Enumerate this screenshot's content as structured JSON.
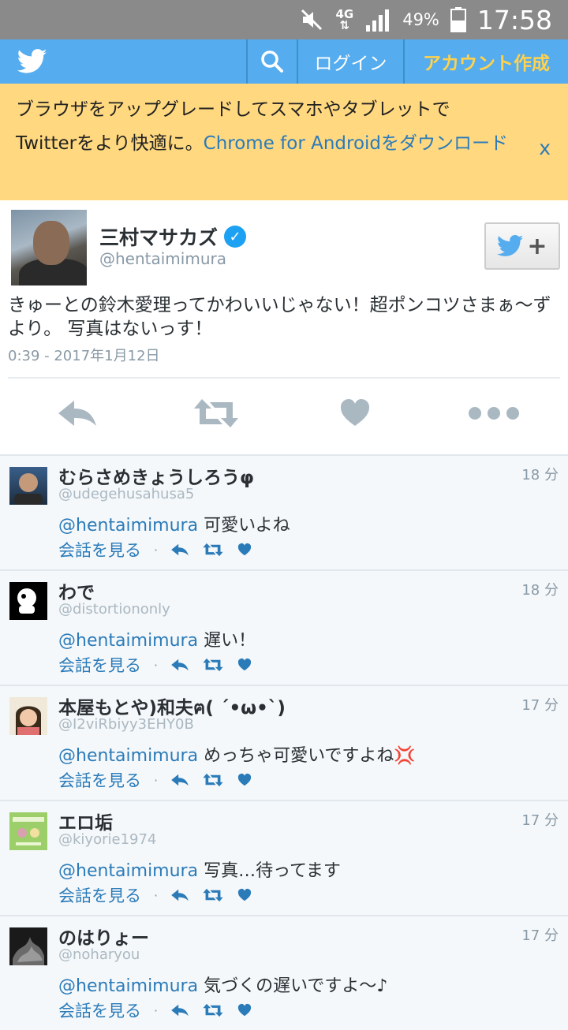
{
  "status_bar": {
    "network": "4G",
    "battery_pct": "49%",
    "time": "17:58"
  },
  "nav": {
    "login": "ログイン",
    "signup": "アカウント作成"
  },
  "banner": {
    "text1": "ブラウザをアップグレードしてスマホやタブレットで",
    "text2": "Twitterをより快適に。",
    "link": "Chrome for Androidをダウンロード",
    "close": "x"
  },
  "tweet": {
    "name": "三村マサカズ",
    "handle": "@hentaimimura",
    "text": "きゅーとの鈴木愛理ってかわいいじゃない！超ポンコツさまぁ〜ずより。 写真はないっす！",
    "timestamp": "0:39 - 2017年1月12日"
  },
  "replies": [
    {
      "name": "むらさめきょうしろうφ",
      "handle": "@udegehusahusa5",
      "time": "18 分",
      "mention": "@hentaimimura",
      "text": "可愛いよね",
      "conversation": "会話を見る"
    },
    {
      "name": "わで",
      "handle": "@distortiononly",
      "time": "18 分",
      "mention": "@hentaimimura",
      "text": "遅い！",
      "conversation": "会話を見る"
    },
    {
      "name": "本屋もとや)和夫ฅ( ´•ω•`)",
      "handle": "@I2viRbiyy3EHY0B",
      "time": "17 分",
      "mention": "@hentaimimura",
      "text": "めっちゃ可愛いですよね💢",
      "conversation": "会話を見る"
    },
    {
      "name": "エロ垢",
      "handle": "@kiyorie1974",
      "time": "17 分",
      "mention": "@hentaimimura",
      "text": "写真…待ってます",
      "conversation": "会話を見る"
    },
    {
      "name": "のはりょー",
      "handle": "@noharyou",
      "time": "17 分",
      "mention": "@hentaimimura",
      "text": "気づくの遅いですよ〜♪",
      "conversation": "会話を見る"
    }
  ],
  "colors": {
    "twitter_blue": "#55acee",
    "banner_bg": "#ffd87f",
    "link": "#2b7bb9",
    "signup": "#ffd24d"
  }
}
